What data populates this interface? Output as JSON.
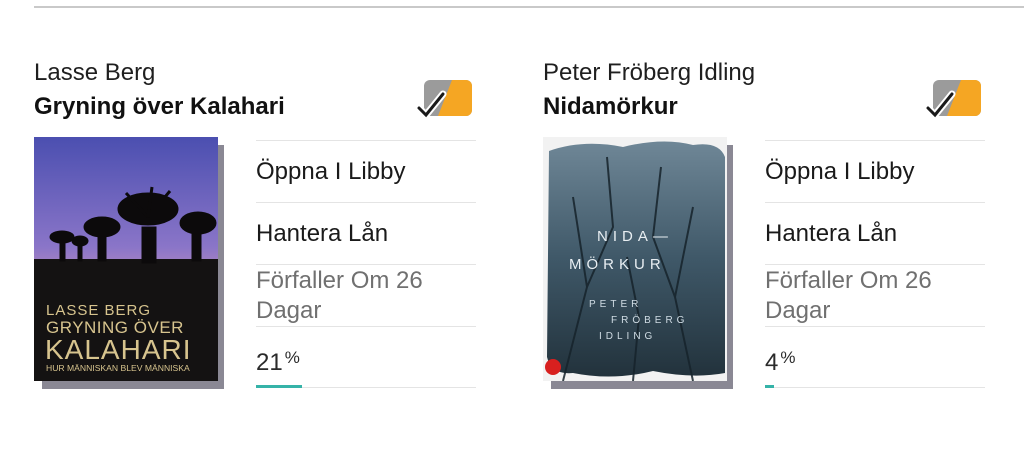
{
  "books": [
    {
      "author": "Lasse Berg",
      "title": "Gryning över Kalahari",
      "cover": {
        "author_text": "LASSE BERG",
        "title_line1": "GRYNING ÖVER",
        "title_line2": "KALAHARI",
        "subtitle": "HUR MÄNNISKAN BLEV MÄNNISKA"
      },
      "actions": {
        "open": "Öppna I Libby",
        "manage": "Hantera Lån"
      },
      "due": "Förfaller Om 26 Dagar",
      "progress": {
        "value": "21",
        "unit": "%",
        "fraction": 0.21
      }
    },
    {
      "author": "Peter Fröberg Idling",
      "title": "Nidamörkur",
      "cover": {
        "title_line1": "NIDA—",
        "title_line2": "MÖRKUR",
        "author_line1": "PETER",
        "author_line2": "FRÖBERG",
        "author_line3": "IDLING"
      },
      "actions": {
        "open": "Öppna I Libby",
        "manage": "Hantera Lån"
      },
      "due": "Förfaller Om 26 Dagar",
      "progress": {
        "value": "4",
        "unit": "%",
        "fraction": 0.04
      }
    }
  ],
  "colors": {
    "progress_bar": "#35b3a8",
    "badge_gray": "#9b9b9b",
    "badge_orange": "#f5a623"
  }
}
